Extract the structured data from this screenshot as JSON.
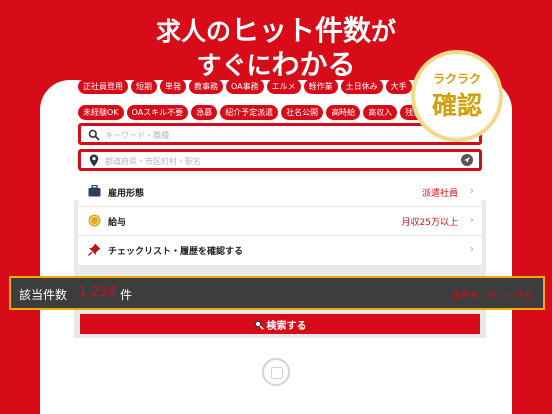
{
  "headline": {
    "line1_pre": "求人の",
    "line1_em": "ヒット件数",
    "line1_post": "が",
    "line2_pre": "すぐに",
    "line2_em": "わかる"
  },
  "badge": {
    "top": "ラクラク",
    "main": "確認"
  },
  "tags": {
    "row1": [
      "正社員登用",
      "短期",
      "単発",
      "教事務",
      "OA事務",
      "エルメ",
      "軽作業",
      "土日休み",
      "大手"
    ],
    "row2": [
      "未経験OK",
      "OAスキル不要",
      "急募",
      "紹介予定派遣",
      "社名公開",
      "高時給",
      "高収入",
      "残業なし"
    ]
  },
  "search": {
    "keyword_placeholder": "キーワード・職種",
    "area_placeholder": "都道府県・市区町村・駅名"
  },
  "list": [
    {
      "label": "雇用形態",
      "value": "派遣社員",
      "icon": "briefcase-icon"
    },
    {
      "label": "給与",
      "value": "月収25万以上",
      "icon": "coin-icon"
    },
    {
      "label": "チェックリスト・履歴を確認する",
      "value": "",
      "icon": "pin-icon"
    }
  ],
  "result": {
    "count_label": "該当件数",
    "count": "1,234",
    "unit": "件",
    "reset": "条件をリセットする"
  },
  "search_button": "検索する",
  "colors": {
    "brand": "#d80c18",
    "accent": "#d59f0c",
    "highlight": "#f2a900"
  }
}
